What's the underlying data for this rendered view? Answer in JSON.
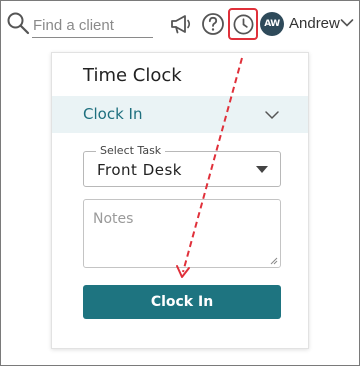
{
  "header": {
    "search": {
      "placeholder": "Find a client",
      "icon": "search-icon"
    },
    "icons": [
      "megaphone-icon",
      "help-icon",
      "clock-icon"
    ],
    "user": {
      "initials": "AW",
      "name": "Andrew",
      "avatar_color": "#2e4a5a"
    }
  },
  "time_clock": {
    "title": "Time Clock",
    "section_label": "Clock In",
    "task_select": {
      "legend": "Select Task",
      "value": "Front Desk"
    },
    "notes": {
      "placeholder": "Notes",
      "value": ""
    },
    "submit_label": "Clock In"
  },
  "colors": {
    "accent": "#1e7480",
    "section_bg": "#eaf3f5",
    "highlight": "#e0303a"
  }
}
